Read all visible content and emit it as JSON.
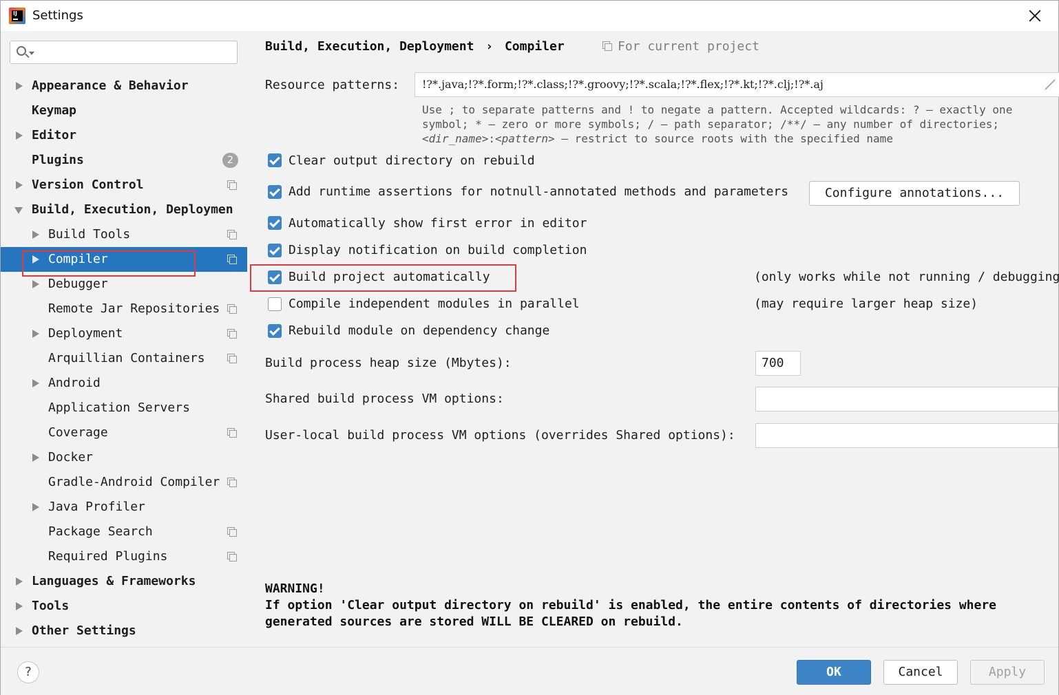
{
  "window": {
    "title": "Settings"
  },
  "sidebar": {
    "search_placeholder": "",
    "items": [
      {
        "label": "Appearance & Behavior"
      },
      {
        "label": "Keymap"
      },
      {
        "label": "Editor"
      },
      {
        "label": "Plugins",
        "badge": "2"
      },
      {
        "label": "Version Control"
      },
      {
        "label": "Build, Execution, Deploymen"
      },
      {
        "label": "Build Tools"
      },
      {
        "label": "Compiler"
      },
      {
        "label": "Debugger"
      },
      {
        "label": "Remote Jar Repositories"
      },
      {
        "label": "Deployment"
      },
      {
        "label": "Arquillian Containers"
      },
      {
        "label": "Android"
      },
      {
        "label": "Application Servers"
      },
      {
        "label": "Coverage"
      },
      {
        "label": "Docker"
      },
      {
        "label": "Gradle-Android Compiler"
      },
      {
        "label": "Java Profiler"
      },
      {
        "label": "Package Search"
      },
      {
        "label": "Required Plugins"
      },
      {
        "label": "Languages & Frameworks"
      },
      {
        "label": "Tools"
      },
      {
        "label": "Other Settings"
      }
    ]
  },
  "header": {
    "breadcrumb_parent": "Build, Execution, Deployment",
    "breadcrumb_sep": "›",
    "breadcrumb_current": "Compiler",
    "scope_label": "For current project"
  },
  "resources": {
    "label": "Resource patterns:",
    "value": "!?*.java;!?*.form;!?*.class;!?*.groovy;!?*.scala;!?*.flex;!?*.kt;!?*.clj;!?*.aj",
    "hint_line1": "Use ; to separate patterns and ! to negate a pattern. Accepted wildcards: ? — exactly one",
    "hint_line2": "symbol; * — zero or more symbols; / — path separator; /**/ — any number of directories;",
    "hint_line3_dir": "<dir_name>",
    "hint_line3_sep": ":",
    "hint_line3_pat": "<pattern>",
    "hint_line3_rest": " — restrict to source roots with the specified name"
  },
  "options": {
    "clear_output": {
      "label": "Clear output directory on rebuild",
      "checked": true
    },
    "runtime_assertions": {
      "label": "Add runtime assertions for notnull-annotated methods and parameters",
      "checked": true
    },
    "configure_annotations": "Configure annotations...",
    "show_first_error": {
      "label": "Automatically show first error in editor",
      "checked": true
    },
    "notify_build": {
      "label": "Display notification on build completion",
      "checked": true
    },
    "build_auto": {
      "label": "Build project automatically",
      "checked": true,
      "note": "(only works while not running / debugging)"
    },
    "compile_parallel": {
      "label": "Compile independent modules in parallel",
      "checked": false,
      "note": "(may require larger heap size)"
    },
    "rebuild_module": {
      "label": "Rebuild module on dependency change",
      "checked": true
    }
  },
  "heap": {
    "label": "Build process heap size (Mbytes):",
    "value": "700"
  },
  "shared_vm": {
    "label": "Shared build process VM options:",
    "value": ""
  },
  "user_vm": {
    "label": "User-local build process VM options (overrides Shared options):",
    "value": ""
  },
  "warning": {
    "title": "WARNING!",
    "line1": "If option 'Clear output directory on rebuild' is enabled, the entire contents of directories where",
    "line2": "generated sources are stored WILL BE CLEARED on rebuild."
  },
  "footer": {
    "help": "?",
    "ok": "OK",
    "cancel": "Cancel",
    "apply": "Apply"
  },
  "colors": {
    "accent": "#3d85c6",
    "selection": "#2675bf",
    "highlight_box": "#e0393e"
  }
}
